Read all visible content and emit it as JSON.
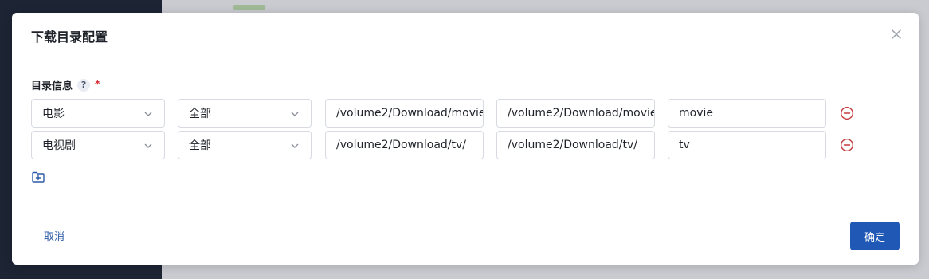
{
  "dialog": {
    "title": "下载目录配置",
    "field_label": "目录信息",
    "help": "?",
    "required_mark": "*",
    "cancel_label": "取消",
    "confirm_label": "确定"
  },
  "rows": [
    {
      "media_type": "电影",
      "category": "全部",
      "download_path": "/volume2/Download/movie",
      "save_path": "/volume2/Download/movie",
      "label": "movie"
    },
    {
      "media_type": "电视剧",
      "category": "全部",
      "download_path": "/volume2/Download/tv/",
      "save_path": "/volume2/Download/tv/",
      "label": "tv"
    }
  ],
  "colors": {
    "primary": "#1f58b5",
    "danger": "#c23b3b",
    "required": "#d6303a"
  }
}
